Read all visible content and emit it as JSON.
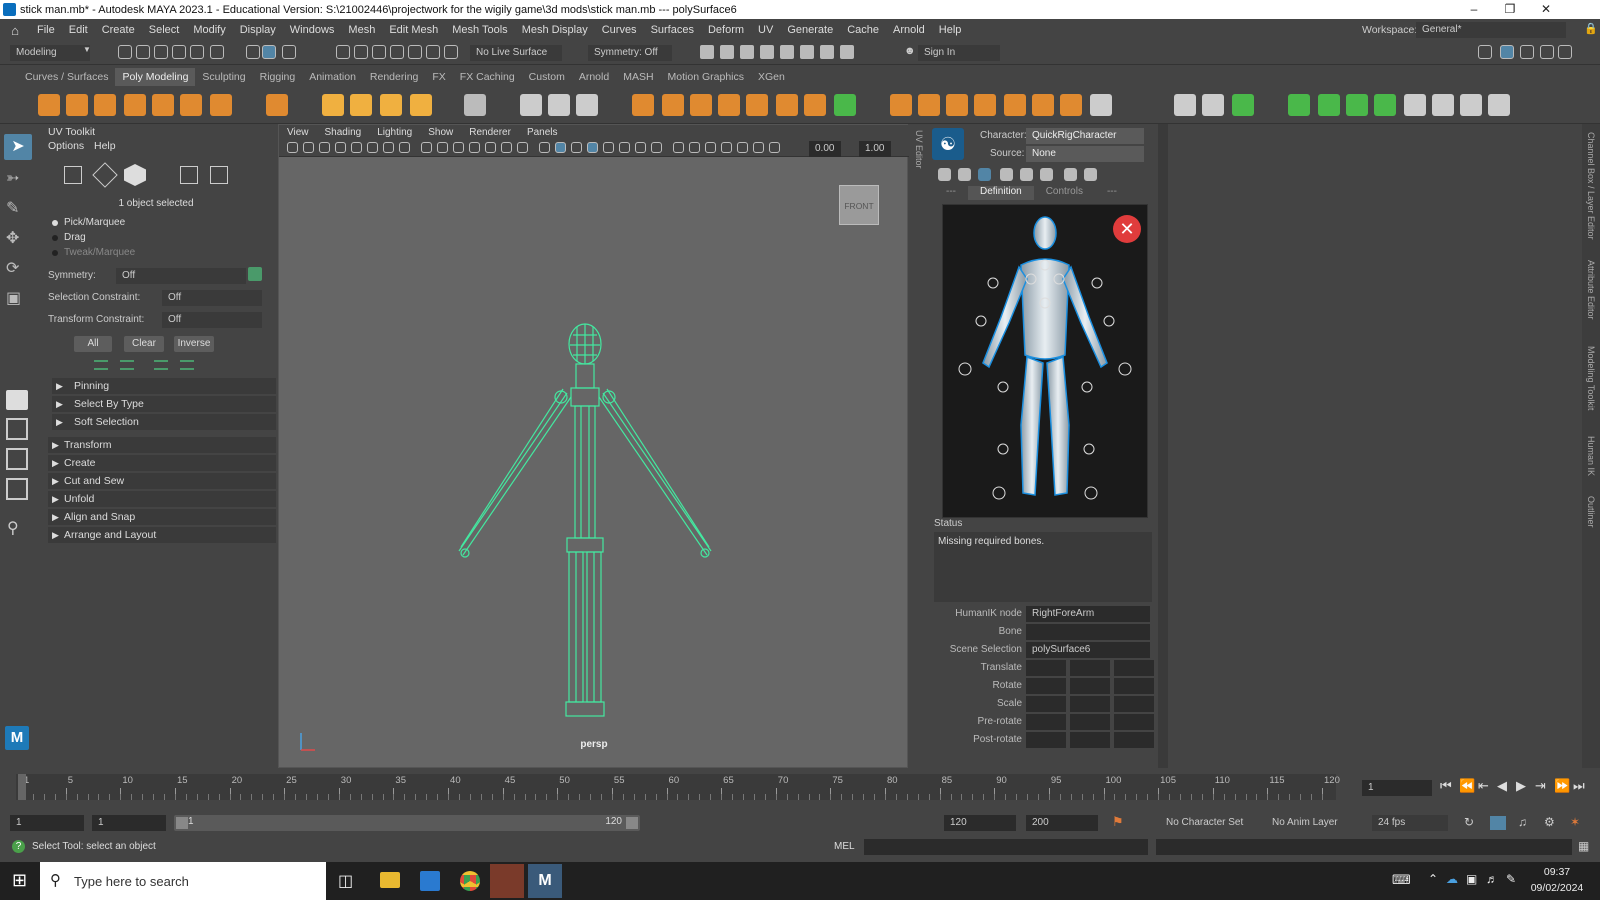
{
  "window": {
    "title": "stick man.mb* - Autodesk MAYA 2023.1 - Educational Version: S:\\21002446\\projectwork for the wigily game\\3d mods\\stick man.mb  ---  polySurface6"
  },
  "menubar": {
    "items": [
      "File",
      "Edit",
      "Create",
      "Select",
      "Modify",
      "Display",
      "Windows",
      "Mesh",
      "Edit Mesh",
      "Mesh Tools",
      "Mesh Display",
      "Curves",
      "Surfaces",
      "Deform",
      "UV",
      "Generate",
      "Cache",
      "Arnold",
      "Help"
    ],
    "workspace_label": "Workspace:",
    "workspace_value": "General*"
  },
  "toolbar": {
    "mode": "Modeling",
    "live_surface": "No Live Surface",
    "symmetry": "Symmetry: Off",
    "sign_in": "Sign In"
  },
  "shelf": {
    "tabs": [
      "Curves / Surfaces",
      "Poly Modeling",
      "Sculpting",
      "Rigging",
      "Animation",
      "Rendering",
      "FX",
      "FX Caching",
      "Custom",
      "Arnold",
      "MASH",
      "Motion Graphics",
      "XGen"
    ],
    "active_tab": 1
  },
  "uv_toolkit": {
    "title": "UV Toolkit",
    "menu": [
      "Options",
      "Help"
    ],
    "selection_info": "1 object selected",
    "modes": [
      "Pick/Marquee",
      "Drag",
      "Tweak/Marquee"
    ],
    "symmetry_label": "Symmetry:",
    "symmetry_value": "Off",
    "selection_constraint_label": "Selection Constraint:",
    "selection_constraint_value": "Off",
    "transform_constraint_label": "Transform Constraint:",
    "transform_constraint_value": "Off",
    "buttons": [
      "All",
      "Clear",
      "Inverse"
    ],
    "sections_a": [
      "Pinning",
      "Select By Type",
      "Soft Selection"
    ],
    "sections_b": [
      "Transform",
      "Create",
      "Cut and Sew",
      "Unfold",
      "Align and Snap",
      "Arrange and Layout"
    ]
  },
  "viewport": {
    "menu": [
      "View",
      "Shading",
      "Lighting",
      "Show",
      "Renderer",
      "Panels"
    ],
    "value_a": "0.00",
    "value_b": "1.00",
    "cube_label": "FRONT",
    "camera_label": "persp",
    "side_tab": "UV Editor"
  },
  "humanik": {
    "character_label": "Character:",
    "character_value": "QuickRigCharacter",
    "source_label": "Source:",
    "source_value": "None",
    "tabs": [
      "---",
      "Definition",
      "Controls",
      "---"
    ],
    "status_label": "Status",
    "status_text": "Missing required bones.",
    "fields": [
      {
        "label": "HumanIK node",
        "value": "RightForeArm"
      },
      {
        "label": "Bone",
        "value": ""
      },
      {
        "label": "Scene Selection",
        "value": "polySurface6"
      }
    ],
    "transform_rows": [
      "Translate",
      "Rotate",
      "Scale",
      "Pre-rotate",
      "Post-rotate"
    ]
  },
  "right_strip_tabs": [
    "Channel Box / Layer Editor",
    "Attribute Editor",
    "Modeling Toolkit",
    "Human IK",
    "Outliner"
  ],
  "timeline": {
    "ticks": [
      "1",
      "5",
      "10",
      "15",
      "20",
      "25",
      "30",
      "35",
      "40",
      "45",
      "50",
      "55",
      "60",
      "65",
      "70",
      "75",
      "80",
      "85",
      "90",
      "95",
      "100",
      "105",
      "110",
      "115",
      "120"
    ],
    "current_frame": "1"
  },
  "range": {
    "start": "1",
    "start_inner": "1",
    "slider_start": "1",
    "slider_end": "120",
    "end_inner": "120",
    "end": "200",
    "character_set": "No Character Set",
    "anim_layer": "No Anim Layer",
    "fps": "24 fps"
  },
  "cmdline": {
    "help_text": "Select Tool: select an object",
    "lang": "MEL"
  },
  "taskbar": {
    "search_placeholder": "Type here to search",
    "time": "09:37",
    "date": "09/02/2024"
  },
  "colors": {
    "bg": "#444444",
    "viewport": "#666666",
    "wire": "#44e8a0",
    "accent": "#3a8fd6"
  }
}
